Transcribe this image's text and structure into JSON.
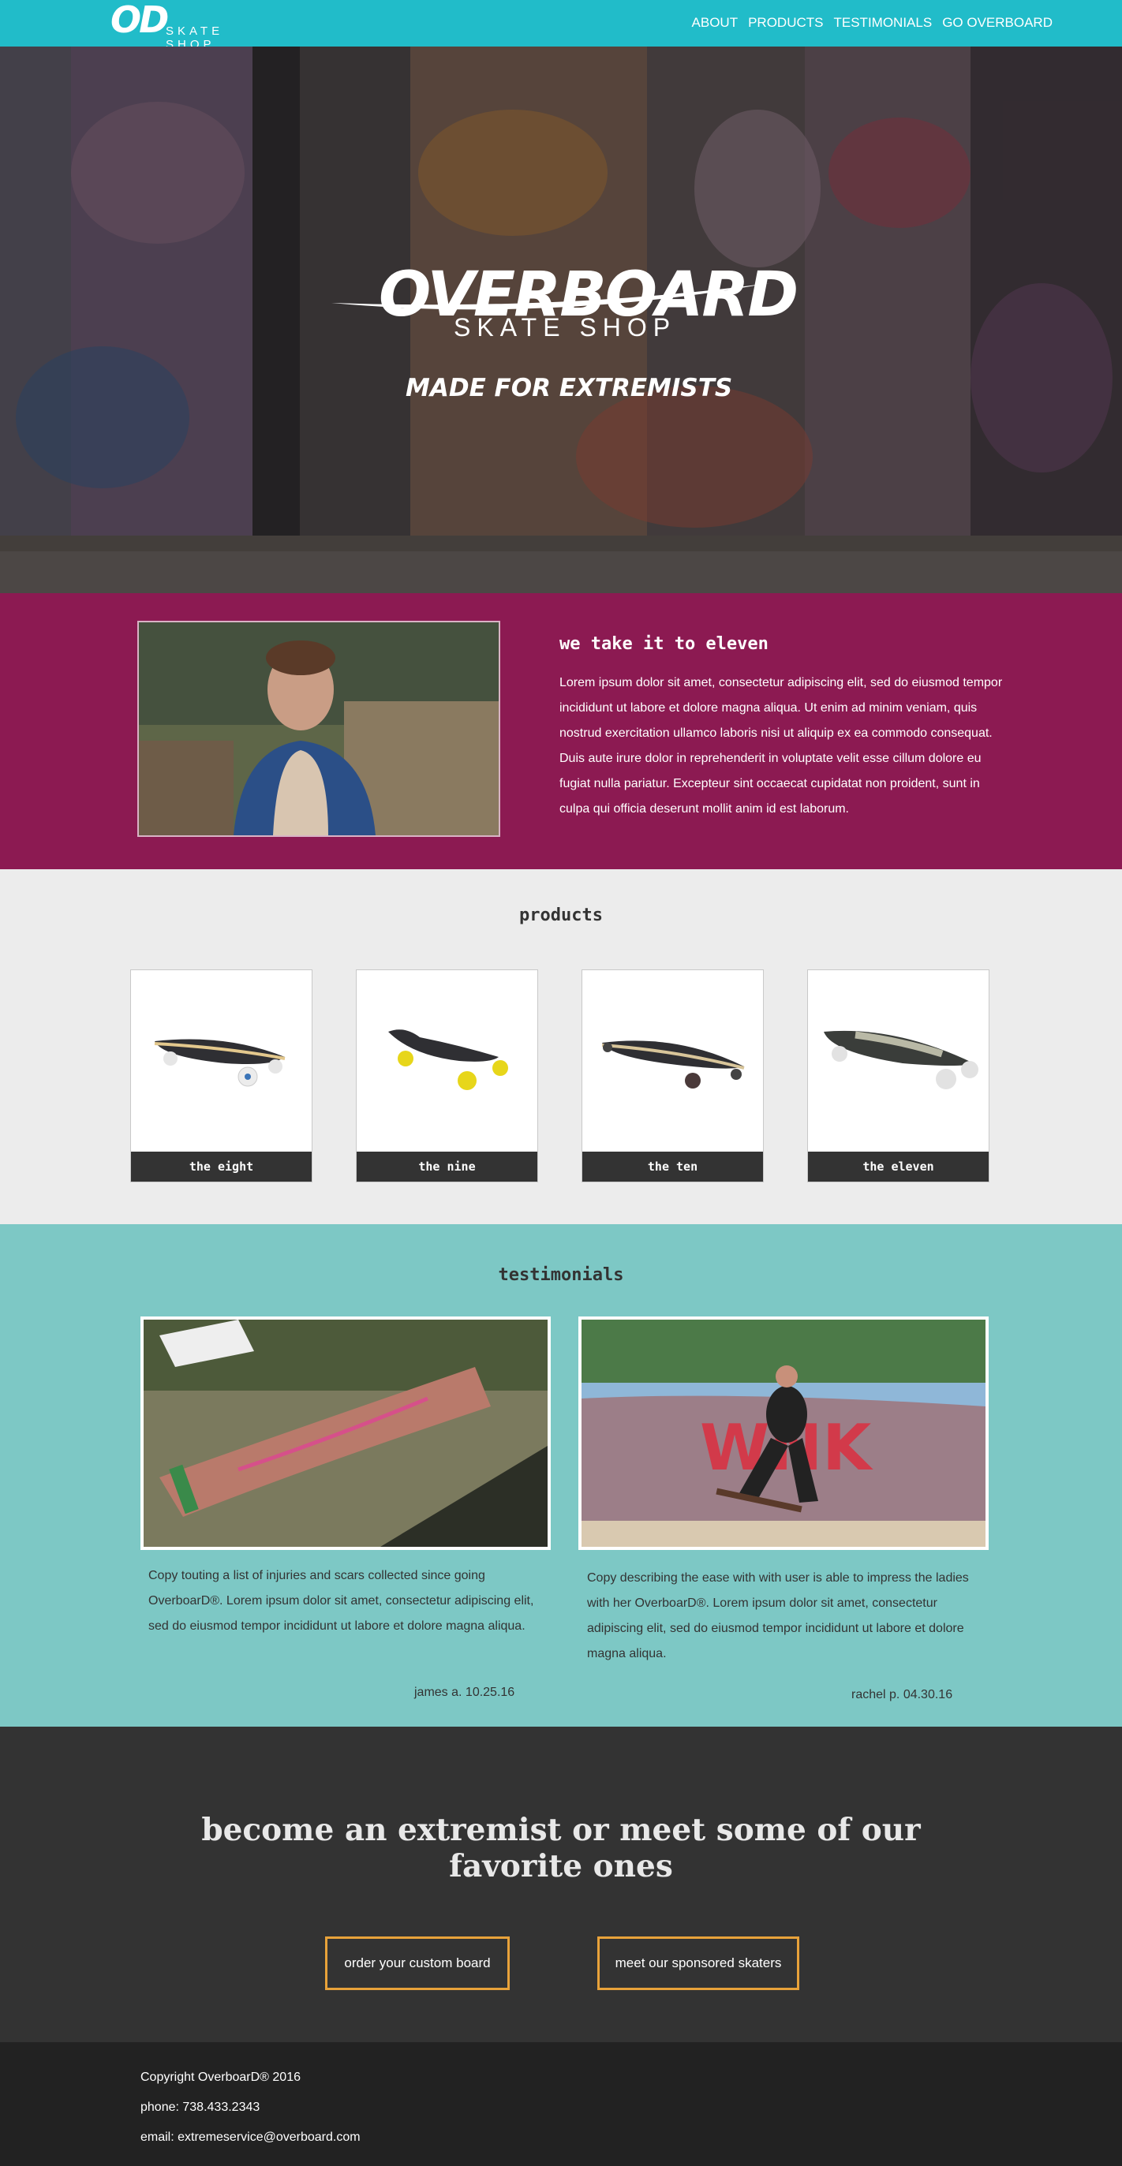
{
  "nav": {
    "logo_mark": "OD",
    "logo_sub": "SKATE SHOP",
    "links": [
      "ABOUT",
      "PRODUCTS",
      "TESTIMONIALS",
      "GO OVERBOARD"
    ]
  },
  "hero": {
    "brand": "OVERBOARD",
    "brand_sub": "SKATE SHOP",
    "tagline": "MADE FOR EXTREMISTS"
  },
  "about": {
    "title": "we take it to eleven",
    "text": "Lorem ipsum dolor sit amet, consectetur adipiscing elit, sed do eiusmod tempor incididunt ut labore et dolore magna aliqua. Ut enim ad minim veniam, quis nostrud exercitation ullamco laboris nisi ut aliquip ex ea commodo consequat. Duis aute irure dolor in reprehenderit in voluptate velit esse cillum dolore eu fugiat nulla pariatur. Excepteur sint occaecat cupidatat non proident, sunt in culpa qui officia deserunt mollit anim id est laborum."
  },
  "products": {
    "title": "products",
    "items": [
      {
        "label": "the eight"
      },
      {
        "label": "the nine"
      },
      {
        "label": "the ten"
      },
      {
        "label": "the eleven"
      }
    ]
  },
  "testimonials": {
    "title": "testimonials",
    "items": [
      {
        "text": "Copy touting a list of injuries and scars collected since going OverboarD®. Lorem ipsum dolor sit amet, consectetur adipiscing elit, sed do eiusmod tempor incididunt ut labore et dolore magna aliqua.",
        "author": "james a. 10.25.16"
      },
      {
        "text": "Copy describing the ease with with user is able to impress the ladies with her OverboarD®. Lorem ipsum dolor sit amet, consectetur adipiscing elit, sed do eiusmod tempor incididunt ut labore et dolore magna aliqua.",
        "author": "rachel p. 04.30.16"
      }
    ]
  },
  "cta": {
    "title": "become an extremist or meet some of our favorite ones",
    "button_custom": "order your custom board",
    "button_skaters": "meet our sponsored skaters"
  },
  "footer": {
    "copyright": "Copyright OverboarD® 2016",
    "phone": "phone: 738.433.2343",
    "email": "email: extremeservice@overboard.com"
  },
  "colors": {
    "nav": "#21bcc9",
    "about": "#8c1a52",
    "products": "#ececec",
    "testimonials": "#7dc8c5",
    "cta": "#333333",
    "button_border": "#e8a23a",
    "footer": "#222222"
  }
}
